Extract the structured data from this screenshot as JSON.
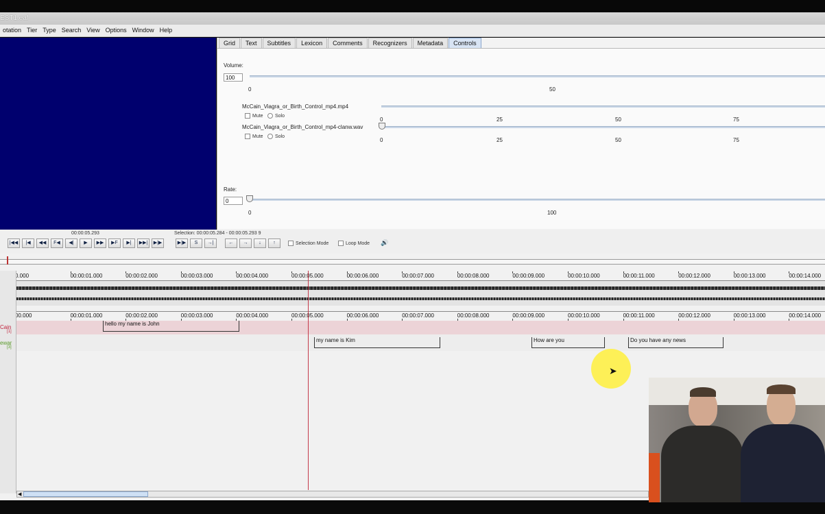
{
  "window": {
    "title": "EST1.eaf"
  },
  "menu": [
    "otation",
    "Tier",
    "Type",
    "Search",
    "View",
    "Options",
    "Window",
    "Help"
  ],
  "tabs": [
    {
      "label": "Grid",
      "active": false
    },
    {
      "label": "Text",
      "active": false
    },
    {
      "label": "Subtitles",
      "active": false
    },
    {
      "label": "Lexicon",
      "active": false
    },
    {
      "label": "Comments",
      "active": false
    },
    {
      "label": "Recognizers",
      "active": false
    },
    {
      "label": "Metadata",
      "active": false
    },
    {
      "label": "Controls",
      "active": true
    }
  ],
  "controls": {
    "volume_label": "Volume:",
    "volume_value": "100",
    "volume_ticks": [
      "0",
      "50"
    ],
    "media": [
      {
        "name": "McCain_Viagra_or_Birth_Control_mp4.mp4",
        "mute": "Mute",
        "solo": "Solo",
        "ticks": [
          "0",
          "25",
          "50",
          "75"
        ]
      },
      {
        "name": "McCain_Viagra_or_Birth_Control_mp4-clanw.wav",
        "mute": "Mute",
        "solo": "Solo",
        "ticks": [
          "0",
          "25",
          "50",
          "75"
        ]
      }
    ],
    "rate_label": "Rate:",
    "rate_value": "0",
    "rate_ticks": [
      "0",
      "100"
    ]
  },
  "player": {
    "current_time": "00:00:05.293",
    "selection": "Selection: 00:00:05.284 - 00:00:05.293  9",
    "buttons": [
      "|◀◀",
      "|◀",
      "◀◀",
      "F◀",
      "◀|",
      "▶",
      "▶▶",
      "▶F",
      "▶|",
      "▶▶|",
      "▶|▶",
      "S",
      "→|",
      "←",
      "→",
      "↓",
      "↑"
    ],
    "selection_mode": "Selection Mode",
    "loop_mode": "Loop Mode"
  },
  "ruler": [
    "0.000",
    "00:00:01.000",
    "00:00:02.000",
    "00:00:03.000",
    "00:00:04.000",
    "00:00:05.000",
    "00:00:06.000",
    "00:00:07.000",
    "00:00:08.000",
    "00:00:09.000",
    "00:00:10.000",
    "00:00:11.000",
    "00:00:12.000",
    "00:00:13.000",
    "00:00:14.000"
  ],
  "ruler2": [
    "00.000",
    "00:00:01.000",
    "00:00:02.000",
    "00:00:03.000",
    "00:00:04.000",
    "00:00:05.000",
    "00:00:06.000",
    "00:00:07.000",
    "00:00:08.000",
    "00:00:09.000",
    "00:00:10.000",
    "00:00:11.000",
    "00:00:12.000",
    "00:00:13.000",
    "00:00:14.000"
  ],
  "tiers": [
    {
      "name": "Cain",
      "sub": "[1]",
      "color": "#c0203a"
    },
    {
      "name": "ewar",
      "sub": "[3]",
      "color": "#5a9a2a"
    }
  ],
  "annotations": [
    {
      "tier": 0,
      "text": "hello my name is  John"
    },
    {
      "tier": 1,
      "text": "my name is Kim"
    },
    {
      "tier": 1,
      "text": "How are you"
    },
    {
      "tier": 1,
      "text": "Do you have any news"
    }
  ]
}
